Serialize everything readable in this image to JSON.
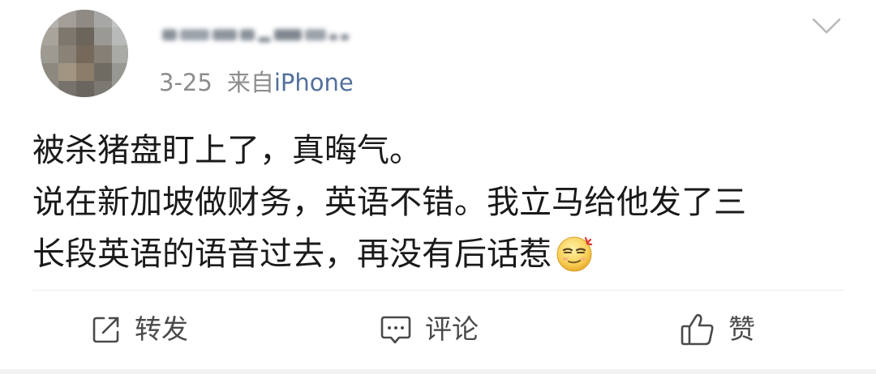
{
  "post": {
    "author_name_blurred": true,
    "date": "3-25",
    "source_prefix": "来自",
    "source": "iPhone",
    "lines": [
      "被杀猪盘盯上了，真晦气。",
      "说在新加坡做财务，英语不错。我立马给他发了三",
      "长段英语的语音过去，再没有后话惹"
    ],
    "emoji": "doge-angry-emoji"
  },
  "actions": {
    "repost_label": "转发",
    "comment_label": "评论",
    "like_label": "赞"
  },
  "colors": {
    "source_link": "#53709a",
    "meta_text": "#8c8c8c",
    "body_text": "#1a1a1a",
    "action_text": "#4a4a4a"
  },
  "icons": {
    "menu": "chevron-down-icon",
    "repost": "share-icon",
    "comment": "comment-icon",
    "like": "thumbs-up-icon"
  }
}
